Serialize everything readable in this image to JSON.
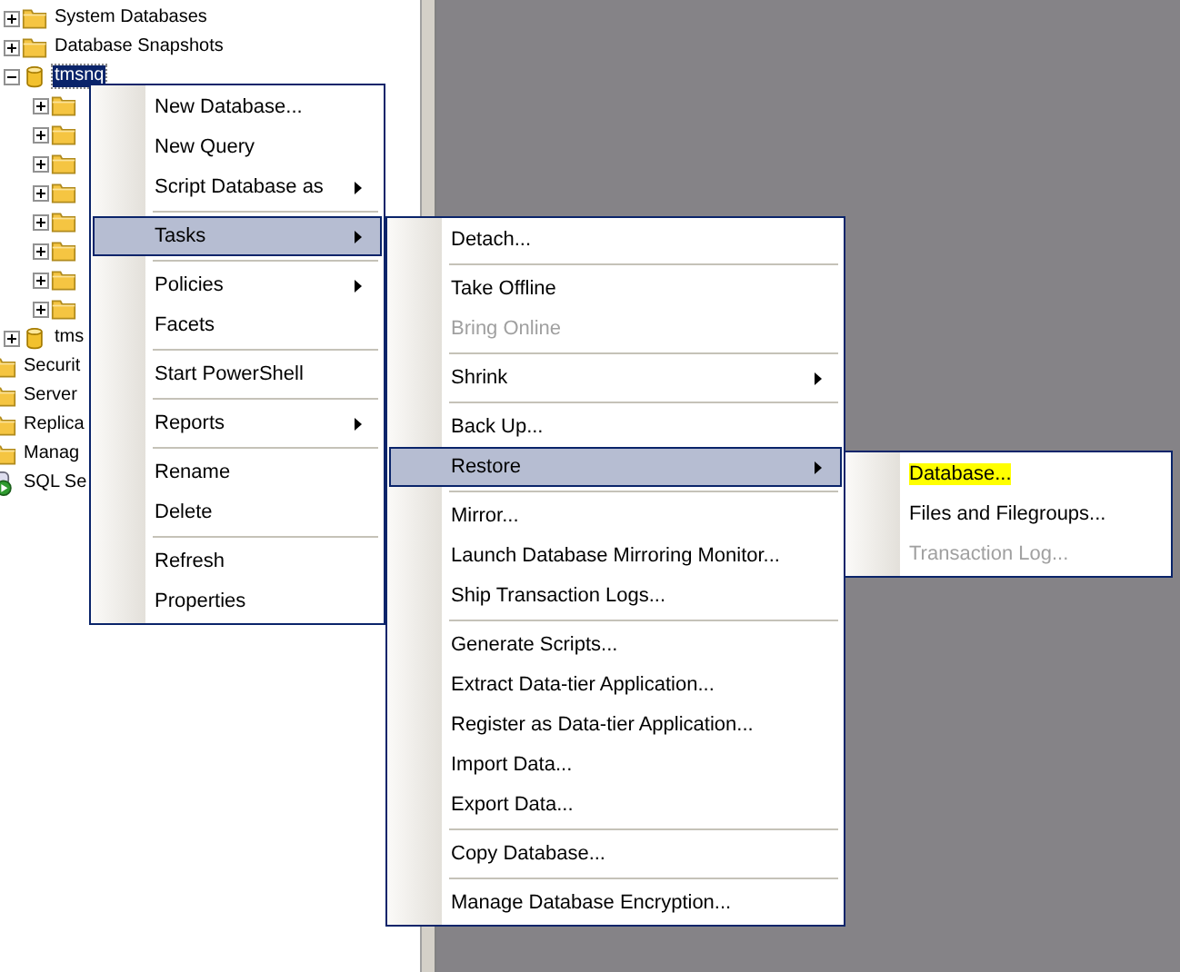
{
  "tree": {
    "database_nodes": [
      {
        "kind": "folder",
        "label": "System Databases",
        "expanded": false,
        "selected": false
      },
      {
        "kind": "folder",
        "label": "Database Snapshots",
        "expanded": false,
        "selected": false
      },
      {
        "kind": "database",
        "label": "tmsnq",
        "expanded": true,
        "selected": true,
        "children": [
          {
            "kind": "folder",
            "expanded": false
          },
          {
            "kind": "folder",
            "expanded": false
          },
          {
            "kind": "folder",
            "expanded": false
          },
          {
            "kind": "folder",
            "expanded": false
          },
          {
            "kind": "folder",
            "expanded": false
          },
          {
            "kind": "folder",
            "expanded": false
          },
          {
            "kind": "folder",
            "expanded": false
          },
          {
            "kind": "folder",
            "expanded": false
          }
        ]
      },
      {
        "kind": "database",
        "label": "tms",
        "expanded": false,
        "selected": false
      }
    ],
    "server_nodes": [
      {
        "kind": "folder",
        "label": "Securit"
      },
      {
        "kind": "folder",
        "label": "Server"
      },
      {
        "kind": "folder",
        "label": "Replica"
      },
      {
        "kind": "folder",
        "label": "Manag"
      },
      {
        "kind": "agent",
        "label": "SQL Se"
      }
    ]
  },
  "menus": [
    {
      "items": [
        {
          "kind": "item",
          "label": "New Database...",
          "selected": false,
          "disabled": false,
          "submenu": false
        },
        {
          "kind": "item",
          "label": "New Query",
          "selected": false,
          "disabled": false,
          "submenu": false
        },
        {
          "kind": "item",
          "label": "Script Database as",
          "selected": false,
          "disabled": false,
          "submenu": true
        },
        {
          "kind": "separator"
        },
        {
          "kind": "item",
          "label": "Tasks",
          "selected": true,
          "disabled": false,
          "submenu": true
        },
        {
          "kind": "separator"
        },
        {
          "kind": "item",
          "label": "Policies",
          "selected": false,
          "disabled": false,
          "submenu": true
        },
        {
          "kind": "item",
          "label": "Facets",
          "selected": false,
          "disabled": false,
          "submenu": false
        },
        {
          "kind": "separator"
        },
        {
          "kind": "item",
          "label": "Start PowerShell",
          "selected": false,
          "disabled": false,
          "submenu": false
        },
        {
          "kind": "separator"
        },
        {
          "kind": "item",
          "label": "Reports",
          "selected": false,
          "disabled": false,
          "submenu": true
        },
        {
          "kind": "separator"
        },
        {
          "kind": "item",
          "label": "Rename",
          "selected": false,
          "disabled": false,
          "submenu": false
        },
        {
          "kind": "item",
          "label": "Delete",
          "selected": false,
          "disabled": false,
          "submenu": false
        },
        {
          "kind": "separator"
        },
        {
          "kind": "item",
          "label": "Refresh",
          "selected": false,
          "disabled": false,
          "submenu": false
        },
        {
          "kind": "item",
          "label": "Properties",
          "selected": false,
          "disabled": false,
          "submenu": false
        }
      ]
    },
    {
      "items": [
        {
          "kind": "item",
          "label": "Detach...",
          "selected": false,
          "disabled": false,
          "submenu": false
        },
        {
          "kind": "separator"
        },
        {
          "kind": "item",
          "label": "Take Offline",
          "selected": false,
          "disabled": false,
          "submenu": false
        },
        {
          "kind": "item",
          "label": "Bring Online",
          "selected": false,
          "disabled": true,
          "submenu": false
        },
        {
          "kind": "separator"
        },
        {
          "kind": "item",
          "label": "Shrink",
          "selected": false,
          "disabled": false,
          "submenu": true
        },
        {
          "kind": "separator"
        },
        {
          "kind": "item",
          "label": "Back Up...",
          "selected": false,
          "disabled": false,
          "submenu": false
        },
        {
          "kind": "item",
          "label": "Restore",
          "selected": true,
          "disabled": false,
          "submenu": true
        },
        {
          "kind": "separator"
        },
        {
          "kind": "item",
          "label": "Mirror...",
          "selected": false,
          "disabled": false,
          "submenu": false
        },
        {
          "kind": "item",
          "label": "Launch Database Mirroring Monitor...",
          "selected": false,
          "disabled": false,
          "submenu": false
        },
        {
          "kind": "item",
          "label": "Ship Transaction Logs...",
          "selected": false,
          "disabled": false,
          "submenu": false
        },
        {
          "kind": "separator"
        },
        {
          "kind": "item",
          "label": "Generate Scripts...",
          "selected": false,
          "disabled": false,
          "submenu": false
        },
        {
          "kind": "item",
          "label": "Extract Data-tier Application...",
          "selected": false,
          "disabled": false,
          "submenu": false
        },
        {
          "kind": "item",
          "label": "Register as Data-tier Application...",
          "selected": false,
          "disabled": false,
          "submenu": false
        },
        {
          "kind": "item",
          "label": "Import Data...",
          "selected": false,
          "disabled": false,
          "submenu": false
        },
        {
          "kind": "item",
          "label": "Export Data...",
          "selected": false,
          "disabled": false,
          "submenu": false
        },
        {
          "kind": "separator"
        },
        {
          "kind": "item",
          "label": "Copy Database...",
          "selected": false,
          "disabled": false,
          "submenu": false
        },
        {
          "kind": "separator"
        },
        {
          "kind": "item",
          "label": "Manage Database Encryption...",
          "selected": false,
          "disabled": false,
          "submenu": false
        }
      ]
    },
    {
      "items": [
        {
          "kind": "item",
          "label": "Database...",
          "selected": false,
          "disabled": false,
          "submenu": false,
          "highlighted": true
        },
        {
          "kind": "item",
          "label": "Files and Filegroups...",
          "selected": false,
          "disabled": false,
          "submenu": false
        },
        {
          "kind": "item",
          "label": "Transaction Log...",
          "selected": false,
          "disabled": true,
          "submenu": false
        }
      ]
    }
  ]
}
